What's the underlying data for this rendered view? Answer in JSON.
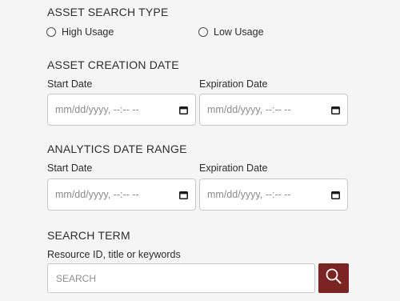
{
  "asset_search_type": {
    "title": "ASSET SEARCH TYPE",
    "options": [
      {
        "label": "High Usage",
        "selected": false
      },
      {
        "label": "Low Usage",
        "selected": false
      }
    ]
  },
  "asset_creation_date": {
    "title": "ASSET CREATION DATE",
    "start_label": "Start Date",
    "end_label": "Expiration Date",
    "start_placeholder": "mm/dd/yyyy, --:-- --",
    "end_placeholder": "mm/dd/yyyy, --:-- --"
  },
  "analytics_date_range": {
    "title": "ANALYTICS DATE RANGE",
    "start_label": "Start Date",
    "end_label": "Expiration Date",
    "start_placeholder": "mm/dd/yyyy, --:-- --",
    "end_placeholder": "mm/dd/yyyy, --:-- --"
  },
  "search_term": {
    "title": "SEARCH TERM",
    "field_label": "Resource ID, title or keywords",
    "placeholder": "SEARCH",
    "button_icon": "search-icon"
  },
  "colors": {
    "accent": "#7b2424",
    "background": "#f5f5f5"
  }
}
